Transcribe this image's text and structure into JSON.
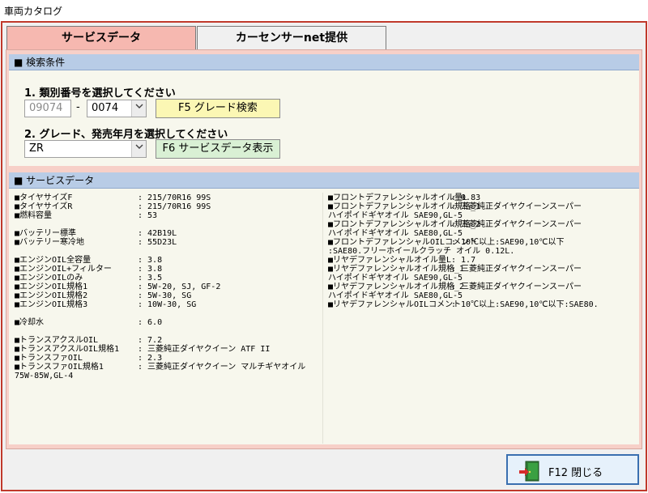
{
  "window": {
    "title": "車両カタログ"
  },
  "tabs": [
    {
      "label": "サービスデータ"
    },
    {
      "label": "カーセンサーnet提供"
    }
  ],
  "search": {
    "header": "■ 検索条件",
    "step1_label": "1. 類別番号を選択してください",
    "type_code": "09074",
    "dash": "-",
    "category_code": "0074",
    "f5_label": "F5 グレード検索",
    "step2_label": "2. グレード、発売年月を選択してください",
    "grade": "ZR",
    "f6_label": "F6 サービスデータ表示"
  },
  "service": {
    "header": "■ サービスデータ",
    "left": [
      {
        "k": "■タイヤサイズF",
        "v": ": 215/70R16 99S"
      },
      {
        "k": "■タイヤサイズR",
        "v": ": 215/70R16 99S"
      },
      {
        "k": "■燃料容量",
        "v": ": 53"
      },
      {
        "k": "",
        "v": ""
      },
      {
        "k": "■バッテリー標準",
        "v": ": 42B19L"
      },
      {
        "k": "■バッテリー寒冷地",
        "v": ": 55D23L"
      },
      {
        "k": "",
        "v": ""
      },
      {
        "k": "■エンジンOIL全容量",
        "v": ": 3.8"
      },
      {
        "k": "■エンジンOIL+フィルター",
        "v": ": 3.8"
      },
      {
        "k": "■エンジンOILのみ",
        "v": ": 3.5"
      },
      {
        "k": "■エンジンOIL規格1",
        "v": ": 5W-20, SJ, GF-2"
      },
      {
        "k": "■エンジンOIL規格2",
        "v": ": 5W-30, SG"
      },
      {
        "k": "■エンジンOIL規格3",
        "v": ": 10W-30, SG"
      },
      {
        "k": "",
        "v": ""
      },
      {
        "k": "■冷却水",
        "v": ": 6.0"
      },
      {
        "k": "",
        "v": ""
      },
      {
        "k": "■トランスアクスルOIL",
        "v": ": 7.2"
      },
      {
        "k": "■トランスアクスルOIL規格1",
        "v": ": 三菱純正ダイヤクイーン ATF II"
      },
      {
        "k": "■トランスファOIL",
        "v": ": 2.3"
      },
      {
        "k": "■トランスファOIL規格1",
        "v": ": 三菱純正ダイヤクイーン マルチギヤオイル"
      },
      {
        "k": "75W-85W,GL-4",
        "v": ""
      }
    ],
    "right": [
      {
        "k": "■フロントデファレンシャルオイル量L",
        "v": ": 0.83"
      },
      {
        "k": "■フロントデファレンシャルオイル規格_1",
        "v": ": 三菱純正ダイヤクイーンスーパー"
      },
      {
        "k": "ハイポイドギヤオイル SAE90,GL-5",
        "v": ""
      },
      {
        "k": "■フロントデファレンシャルオイル規格_2",
        "v": ": 三菱純正ダイヤクイーンスーパー"
      },
      {
        "k": "ハイポイドギヤオイル SAE80,GL-5",
        "v": ""
      },
      {
        "k": "■フロントデファレンシャルOILコメント",
        "v": ": 10℃以上:SAE90,10℃以下"
      },
      {
        "k": ":SAE80.フリーホイールクラッチ オイル 0.12L.",
        "v": ""
      },
      {
        "k": "■リヤデファレンシャルオイル量L",
        "v": ": 1.7"
      },
      {
        "k": "■リヤデファレンシャルオイル規格_1",
        "v": ": 三菱純正ダイヤクイーンスーパー"
      },
      {
        "k": "ハイポイドギヤオイル SAE90,GL-5",
        "v": ""
      },
      {
        "k": "■リヤデファレンシャルオイル規格_2",
        "v": ": 三菱純正ダイヤクイーンスーパー"
      },
      {
        "k": "ハイポイドギヤオイル SAE80,GL-5",
        "v": ""
      },
      {
        "k": "■リヤデファレンシャルOILコメント",
        "v": ": 10℃以上:SAE90,10℃以下:SAE80."
      }
    ]
  },
  "footer": {
    "close_label": "F12 閉じる"
  },
  "colors": {
    "accent_border": "#c0392b",
    "active_tab": "#f6b8b0",
    "section_header": "#b8cce6",
    "f5_button": "#fbf7b4",
    "f6_button": "#d9f0d4",
    "close_button_border": "#3a6fb0"
  },
  "icons": {
    "close": "exit-door-icon",
    "combo": "chevron-down-icon"
  }
}
